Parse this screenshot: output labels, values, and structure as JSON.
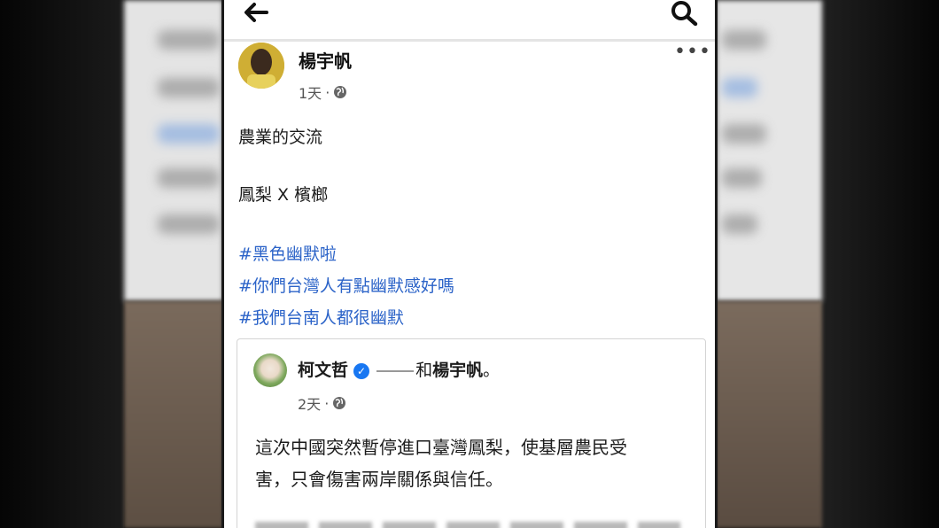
{
  "post": {
    "author": "楊宇帆",
    "time": "1天",
    "dot": "·",
    "more": "•••",
    "lines": [
      "農業的交流",
      "鳳梨 X 檳榔"
    ],
    "hashtags": [
      "#黑色幽默啦",
      "#你們台灣人有點幽默感好嗎",
      "#我們台南人都很幽默"
    ]
  },
  "shared": {
    "author": "柯文哲",
    "connector": "和",
    "with": "楊宇帆",
    "period": "。",
    "time": "2天",
    "dot": "·",
    "text_lines": [
      "這次中國突然暫停進口臺灣鳳梨，使基層農民受",
      "害，只會傷害兩岸關係與信任。"
    ]
  },
  "icons": {
    "back": "back-arrow-icon",
    "search": "search-icon",
    "globe": "globe-icon",
    "verified": "verified-badge-icon"
  },
  "colors": {
    "hashtag": "#2b63c8",
    "verified": "#1877f2"
  }
}
